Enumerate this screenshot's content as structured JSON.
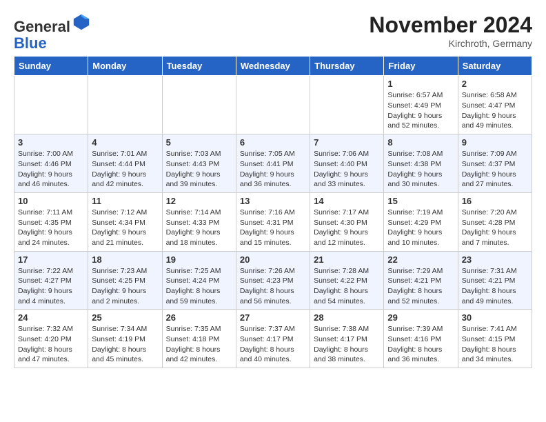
{
  "header": {
    "logo_line1": "General",
    "logo_line2": "Blue",
    "month_title": "November 2024",
    "location": "Kirchroth, Germany"
  },
  "weekdays": [
    "Sunday",
    "Monday",
    "Tuesday",
    "Wednesday",
    "Thursday",
    "Friday",
    "Saturday"
  ],
  "weeks": [
    [
      {
        "day": "",
        "info": ""
      },
      {
        "day": "",
        "info": ""
      },
      {
        "day": "",
        "info": ""
      },
      {
        "day": "",
        "info": ""
      },
      {
        "day": "",
        "info": ""
      },
      {
        "day": "1",
        "info": "Sunrise: 6:57 AM\nSunset: 4:49 PM\nDaylight: 9 hours and 52 minutes."
      },
      {
        "day": "2",
        "info": "Sunrise: 6:58 AM\nSunset: 4:47 PM\nDaylight: 9 hours and 49 minutes."
      }
    ],
    [
      {
        "day": "3",
        "info": "Sunrise: 7:00 AM\nSunset: 4:46 PM\nDaylight: 9 hours and 46 minutes."
      },
      {
        "day": "4",
        "info": "Sunrise: 7:01 AM\nSunset: 4:44 PM\nDaylight: 9 hours and 42 minutes."
      },
      {
        "day": "5",
        "info": "Sunrise: 7:03 AM\nSunset: 4:43 PM\nDaylight: 9 hours and 39 minutes."
      },
      {
        "day": "6",
        "info": "Sunrise: 7:05 AM\nSunset: 4:41 PM\nDaylight: 9 hours and 36 minutes."
      },
      {
        "day": "7",
        "info": "Sunrise: 7:06 AM\nSunset: 4:40 PM\nDaylight: 9 hours and 33 minutes."
      },
      {
        "day": "8",
        "info": "Sunrise: 7:08 AM\nSunset: 4:38 PM\nDaylight: 9 hours and 30 minutes."
      },
      {
        "day": "9",
        "info": "Sunrise: 7:09 AM\nSunset: 4:37 PM\nDaylight: 9 hours and 27 minutes."
      }
    ],
    [
      {
        "day": "10",
        "info": "Sunrise: 7:11 AM\nSunset: 4:35 PM\nDaylight: 9 hours and 24 minutes."
      },
      {
        "day": "11",
        "info": "Sunrise: 7:12 AM\nSunset: 4:34 PM\nDaylight: 9 hours and 21 minutes."
      },
      {
        "day": "12",
        "info": "Sunrise: 7:14 AM\nSunset: 4:33 PM\nDaylight: 9 hours and 18 minutes."
      },
      {
        "day": "13",
        "info": "Sunrise: 7:16 AM\nSunset: 4:31 PM\nDaylight: 9 hours and 15 minutes."
      },
      {
        "day": "14",
        "info": "Sunrise: 7:17 AM\nSunset: 4:30 PM\nDaylight: 9 hours and 12 minutes."
      },
      {
        "day": "15",
        "info": "Sunrise: 7:19 AM\nSunset: 4:29 PM\nDaylight: 9 hours and 10 minutes."
      },
      {
        "day": "16",
        "info": "Sunrise: 7:20 AM\nSunset: 4:28 PM\nDaylight: 9 hours and 7 minutes."
      }
    ],
    [
      {
        "day": "17",
        "info": "Sunrise: 7:22 AM\nSunset: 4:27 PM\nDaylight: 9 hours and 4 minutes."
      },
      {
        "day": "18",
        "info": "Sunrise: 7:23 AM\nSunset: 4:25 PM\nDaylight: 9 hours and 2 minutes."
      },
      {
        "day": "19",
        "info": "Sunrise: 7:25 AM\nSunset: 4:24 PM\nDaylight: 8 hours and 59 minutes."
      },
      {
        "day": "20",
        "info": "Sunrise: 7:26 AM\nSunset: 4:23 PM\nDaylight: 8 hours and 56 minutes."
      },
      {
        "day": "21",
        "info": "Sunrise: 7:28 AM\nSunset: 4:22 PM\nDaylight: 8 hours and 54 minutes."
      },
      {
        "day": "22",
        "info": "Sunrise: 7:29 AM\nSunset: 4:21 PM\nDaylight: 8 hours and 52 minutes."
      },
      {
        "day": "23",
        "info": "Sunrise: 7:31 AM\nSunset: 4:21 PM\nDaylight: 8 hours and 49 minutes."
      }
    ],
    [
      {
        "day": "24",
        "info": "Sunrise: 7:32 AM\nSunset: 4:20 PM\nDaylight: 8 hours and 47 minutes."
      },
      {
        "day": "25",
        "info": "Sunrise: 7:34 AM\nSunset: 4:19 PM\nDaylight: 8 hours and 45 minutes."
      },
      {
        "day": "26",
        "info": "Sunrise: 7:35 AM\nSunset: 4:18 PM\nDaylight: 8 hours and 42 minutes."
      },
      {
        "day": "27",
        "info": "Sunrise: 7:37 AM\nSunset: 4:17 PM\nDaylight: 8 hours and 40 minutes."
      },
      {
        "day": "28",
        "info": "Sunrise: 7:38 AM\nSunset: 4:17 PM\nDaylight: 8 hours and 38 minutes."
      },
      {
        "day": "29",
        "info": "Sunrise: 7:39 AM\nSunset: 4:16 PM\nDaylight: 8 hours and 36 minutes."
      },
      {
        "day": "30",
        "info": "Sunrise: 7:41 AM\nSunset: 4:15 PM\nDaylight: 8 hours and 34 minutes."
      }
    ]
  ]
}
